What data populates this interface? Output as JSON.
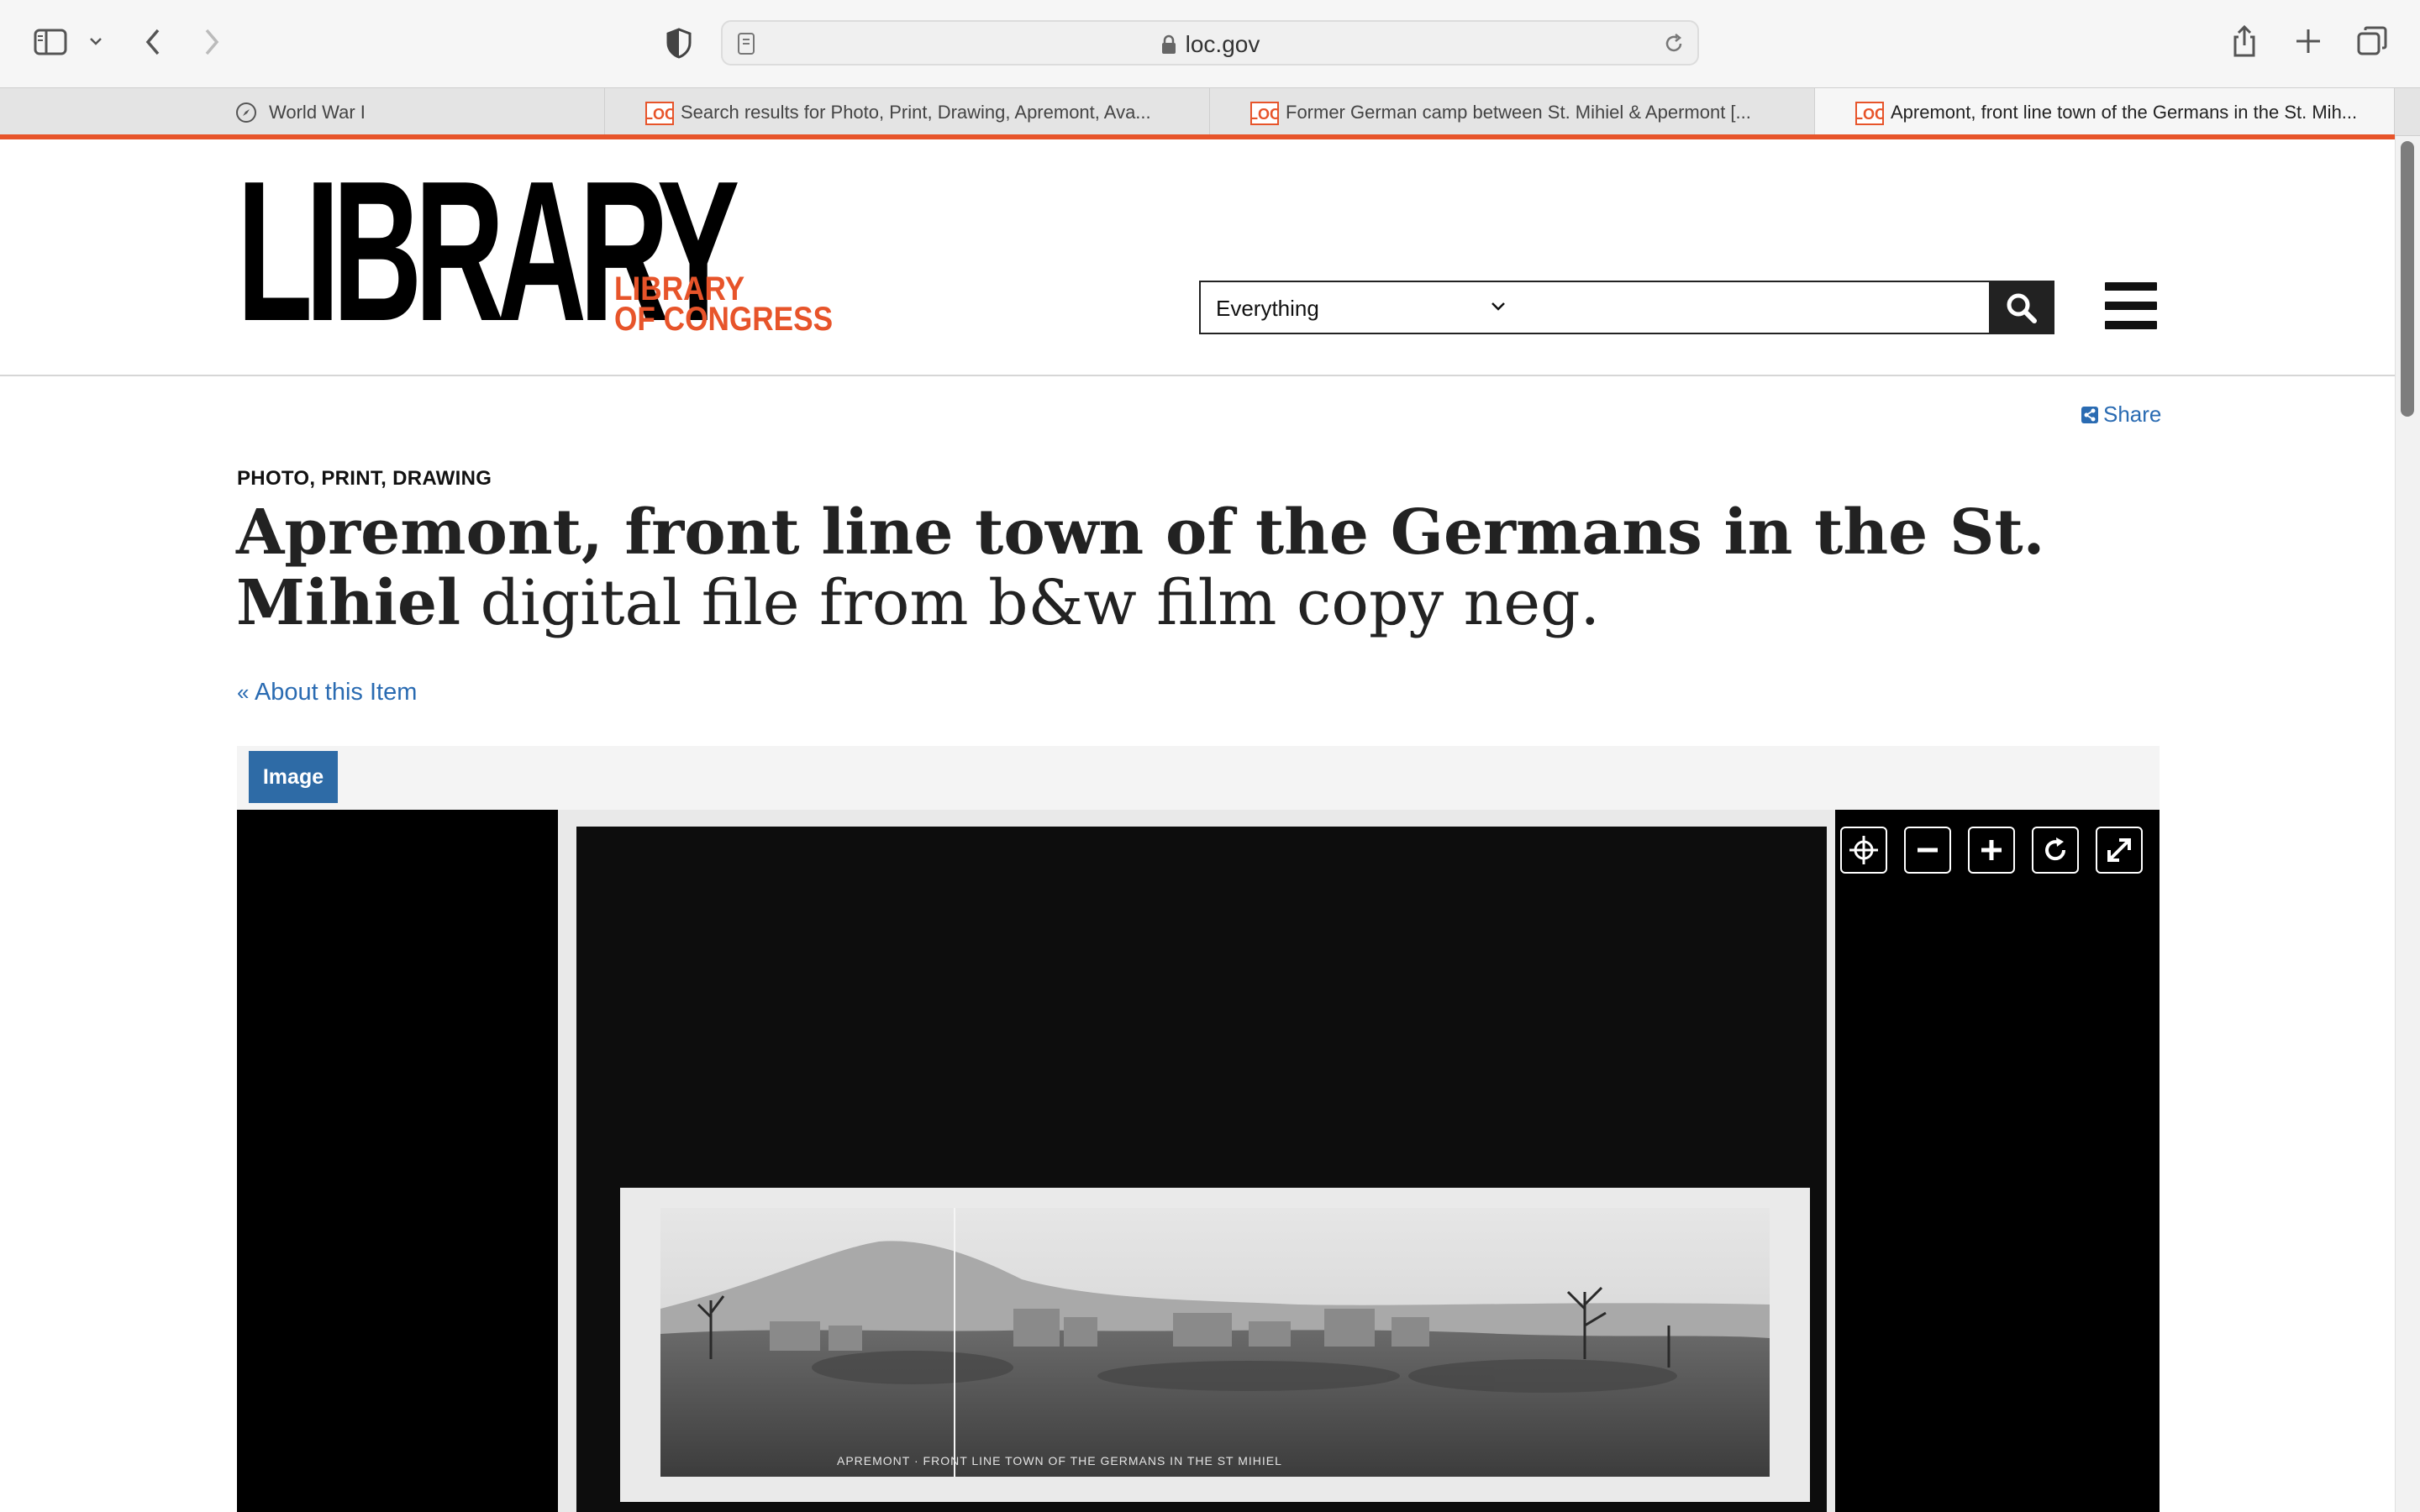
{
  "browser": {
    "url": "loc.gov",
    "tabs": [
      {
        "label": "World War I",
        "active": false
      },
      {
        "label": "Search results for Photo, Print, Drawing, Apremont, Ava...",
        "active": false
      },
      {
        "label": "Former German camp between St. Mihiel & Apermont [...",
        "active": false
      },
      {
        "label": "Apremont, front line town of the Germans in the St. Mih...",
        "active": true
      }
    ]
  },
  "header": {
    "logo_big": "LIBRARY",
    "logo_line1": "LIBRARY",
    "logo_line2": "OF CONGRESS",
    "search_scope": "Everything",
    "search_value": ""
  },
  "page": {
    "share_label": "Share",
    "format": "PHOTO, PRINT, DRAWING",
    "title_bold": "Apremont, front line town of the Germans in the St. Mihiel",
    "title_rest": " digital file from b&w film copy neg.",
    "about_link": "About this Item",
    "viewer_tab": "Image"
  },
  "colors": {
    "accent": "#e7542a",
    "link": "#2a6bb2",
    "tab_blue": "#2e6ba6"
  }
}
